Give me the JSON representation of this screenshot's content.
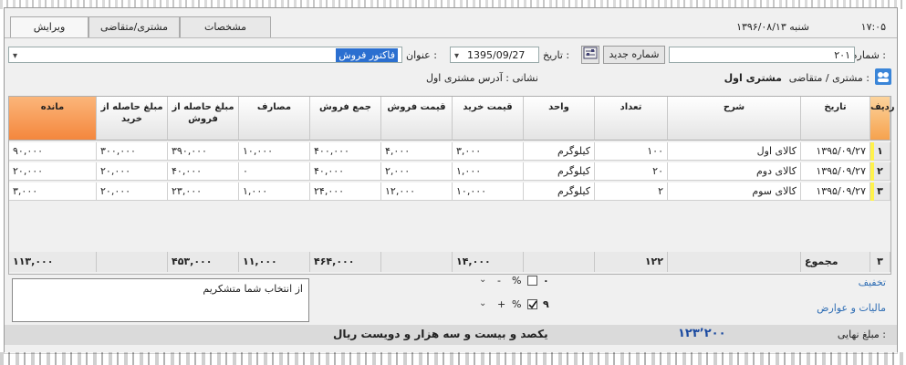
{
  "tabs": [
    "ویرایش",
    "مشتری/متقاضی",
    "مشخصات"
  ],
  "clock": {
    "time": "۱۷:۰۵",
    "date": "شنبه ۱۳۹۶/۰۸/۱۳"
  },
  "form": {
    "number_label": "شماره :",
    "number_value": "۲۰۱",
    "new_number_button": "شماره جدید",
    "date_label": "تاریخ :",
    "date_value": "1395/09/27",
    "title_label": "عنوان :",
    "title_value": "فاکتور فروش",
    "customer_label": "مشتری / متقاضی :",
    "customer_value": "مشتری اول",
    "address_label": "نشانی : آدرس مشتری اول"
  },
  "grid": {
    "columns": [
      "ردیف",
      "تاریخ",
      "شرح",
      "تعداد",
      "واحد",
      "قیمت خرید",
      "قیمت فروش",
      "جمع فروش",
      "مصارف",
      "مبلغ حاصله از فروش",
      "مبلغ حاصله از خرید",
      "مانده"
    ],
    "rows": [
      {
        "idx": "۱",
        "date": "۱۳۹۵/۰۹/۲۷",
        "desc": "کالای اول",
        "qty": "۱۰۰",
        "unit": "کیلوگرم",
        "buy": "۳,۰۰۰",
        "sell": "۴,۰۰۰",
        "sum": "۴۰۰,۰۰۰",
        "cost": "۱۰,۰۰۰",
        "from_sell": "۳۹۰,۰۰۰",
        "from_buy": "۳۰۰,۰۰۰",
        "remain": "۹۰,۰۰۰"
      },
      {
        "idx": "۲",
        "date": "۱۳۹۵/۰۹/۲۷",
        "desc": "کالای دوم",
        "qty": "۲۰",
        "unit": "کیلوگرم",
        "buy": "۱,۰۰۰",
        "sell": "۲,۰۰۰",
        "sum": "۴۰,۰۰۰",
        "cost": "۰",
        "from_sell": "۴۰,۰۰۰",
        "from_buy": "۲۰,۰۰۰",
        "remain": "۲۰,۰۰۰"
      },
      {
        "idx": "۳",
        "date": "۱۳۹۵/۰۹/۲۷",
        "desc": "کالای سوم",
        "qty": "۲",
        "unit": "کیلوگرم",
        "buy": "۱۰,۰۰۰",
        "sell": "۱۲,۰۰۰",
        "sum": "۲۴,۰۰۰",
        "cost": "۱,۰۰۰",
        "from_sell": "۲۳,۰۰۰",
        "from_buy": "۲۰,۰۰۰",
        "remain": "۳,۰۰۰"
      }
    ],
    "totals": {
      "count": "۳",
      "label": "مجموع",
      "qty": "۱۲۲",
      "buy": "۱۴,۰۰۰",
      "sum": "۴۶۴,۰۰۰",
      "cost": "۱۱,۰۰۰",
      "from_sell": "۴۵۳,۰۰۰",
      "remain": "۱۱۳,۰۰۰"
    }
  },
  "note": "از انتخاب شما متشکریم",
  "discount": {
    "label": "تخفیف",
    "value": "۰",
    "percent": "%",
    "sign": "-"
  },
  "tax": {
    "label": "مالیات و عوارض",
    "value": "۹",
    "percent": "%",
    "sign": "+"
  },
  "final": {
    "label": "مبلغ نهایی :",
    "amount": "۱۲۳٬۲۰۰",
    "words": "یکصد و بیست و سه هزار و دویست ریال"
  },
  "colors": {
    "header_orange": "#f4873d",
    "row_marker": "#fff24b",
    "amount_blue": "#1b4aa0"
  }
}
